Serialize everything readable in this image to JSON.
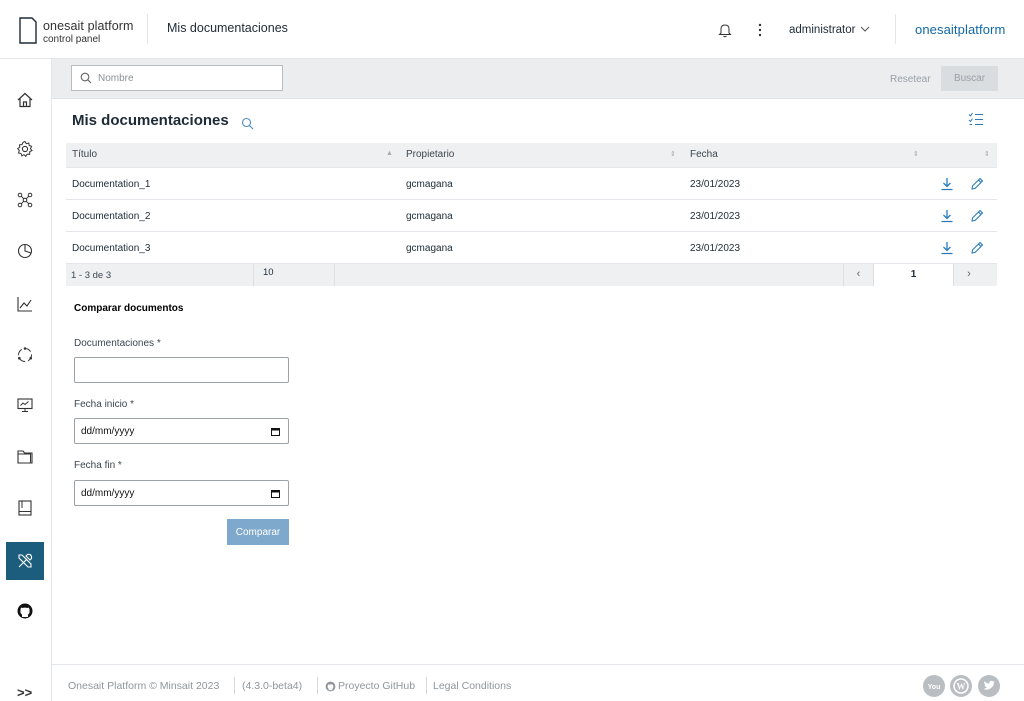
{
  "header": {
    "logo_line1": "onesait platform",
    "logo_line2": "control panel",
    "page_title": "Mis documentaciones",
    "user": "administrator",
    "brand": "onesaitplatform"
  },
  "sidebar": {
    "items": [
      {
        "icon": "home-icon"
      },
      {
        "icon": "gear-icon"
      },
      {
        "icon": "network-icon"
      },
      {
        "icon": "pie-chart-icon"
      },
      {
        "icon": "line-chart-icon"
      },
      {
        "icon": "cycle-icon"
      },
      {
        "icon": "presentation-icon"
      },
      {
        "icon": "folder-icon"
      },
      {
        "icon": "book-icon"
      },
      {
        "icon": "tools-icon",
        "active": true
      },
      {
        "icon": "github-icon"
      }
    ],
    "expand_label": ">>"
  },
  "search": {
    "placeholder": "Nombre",
    "reset_label": "Resetear",
    "search_label": "Buscar"
  },
  "main": {
    "title": "Mis documentaciones"
  },
  "table": {
    "columns": [
      "Título",
      "Propietario",
      "Fecha"
    ],
    "rows": [
      {
        "title": "Documentation_1",
        "owner": "gcmagana",
        "date": "23/01/2023"
      },
      {
        "title": "Documentation_2",
        "owner": "gcmagana",
        "date": "23/01/2023"
      },
      {
        "title": "Documentation_3",
        "owner": "gcmagana",
        "date": "23/01/2023"
      }
    ],
    "pagination": {
      "range": "1 - 3 de 3",
      "page_size": "10",
      "current_page": "1",
      "prev": "‹",
      "next": "›"
    }
  },
  "compare": {
    "title": "Comparar documentos",
    "docs_label": "Documentaciones *",
    "docs_value": "",
    "start_label": "Fecha inicio *",
    "start_value": "dd/mm/yyyy",
    "end_label": "Fecha fin *",
    "end_value": "dd/mm/yyyy",
    "button": "Comparar"
  },
  "footer": {
    "copyright": "Onesait Platform © Minsait 2023",
    "version": "(4.3.0-beta4)",
    "github": "Proyecto GitHub",
    "legal": "Legal Conditions",
    "social": [
      "youtube-icon",
      "wordpress-icon",
      "twitter-icon"
    ]
  },
  "colors": {
    "accent": "#1168a7",
    "sidebar_active": "#1c5d7e",
    "compare_button": "#7fa9cc"
  }
}
